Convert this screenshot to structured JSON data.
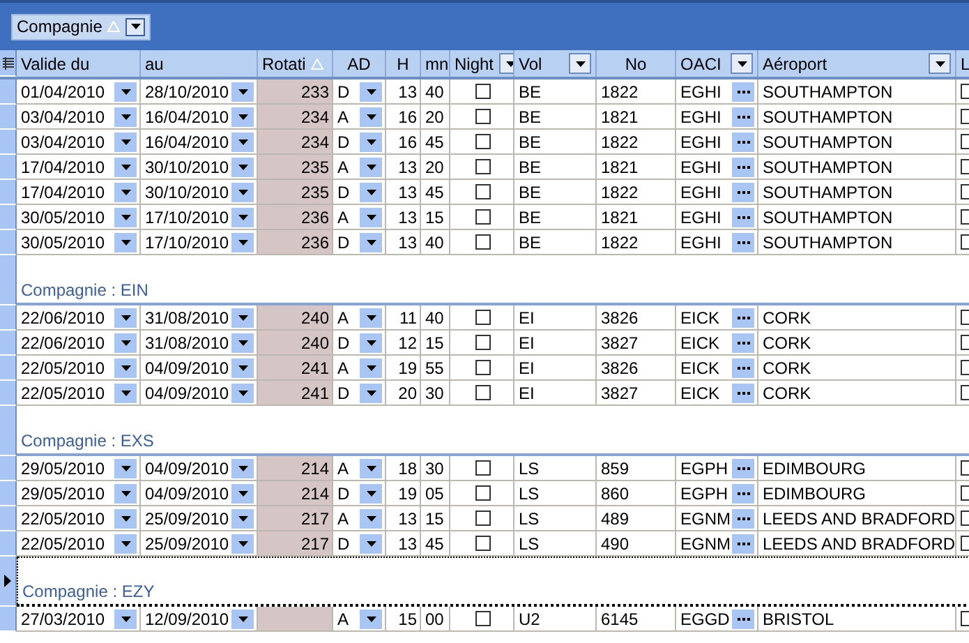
{
  "group_by": {
    "label": "Compagnie",
    "sorted": true,
    "filter": true
  },
  "columns": [
    {
      "label": "Valide du"
    },
    {
      "label": "au"
    },
    {
      "label": "Rotati",
      "sorted": true
    },
    {
      "label": "AD"
    },
    {
      "label": "H"
    },
    {
      "label": "mn"
    },
    {
      "label": "Night",
      "filter": true
    },
    {
      "label": "Vol",
      "filter": true
    },
    {
      "label": "No"
    },
    {
      "label": "OACI",
      "filter": true
    },
    {
      "label": "Aéroport",
      "filter": true
    },
    {
      "label": "L"
    }
  ],
  "groups": [
    {
      "rows": [
        {
          "valid_from": "01/04/2010",
          "valid_to": "28/10/2010",
          "rotation": "233",
          "ad": "D",
          "h": "13",
          "mn": "40",
          "night": false,
          "vol": "BE",
          "no": "1822",
          "oaci": "EGHI",
          "airport": "SOUTHAMPTON",
          "l": false
        },
        {
          "valid_from": "03/04/2010",
          "valid_to": "16/04/2010",
          "rotation": "234",
          "ad": "A",
          "h": "16",
          "mn": "20",
          "night": false,
          "vol": "BE",
          "no": "1821",
          "oaci": "EGHI",
          "airport": "SOUTHAMPTON",
          "l": false
        },
        {
          "valid_from": "03/04/2010",
          "valid_to": "16/04/2010",
          "rotation": "234",
          "ad": "D",
          "h": "16",
          "mn": "45",
          "night": false,
          "vol": "BE",
          "no": "1822",
          "oaci": "EGHI",
          "airport": "SOUTHAMPTON",
          "l": false
        },
        {
          "valid_from": "17/04/2010",
          "valid_to": "30/10/2010",
          "rotation": "235",
          "ad": "A",
          "h": "13",
          "mn": "20",
          "night": false,
          "vol": "BE",
          "no": "1821",
          "oaci": "EGHI",
          "airport": "SOUTHAMPTON",
          "l": false
        },
        {
          "valid_from": "17/04/2010",
          "valid_to": "30/10/2010",
          "rotation": "235",
          "ad": "D",
          "h": "13",
          "mn": "45",
          "night": false,
          "vol": "BE",
          "no": "1822",
          "oaci": "EGHI",
          "airport": "SOUTHAMPTON",
          "l": false
        },
        {
          "valid_from": "30/05/2010",
          "valid_to": "17/10/2010",
          "rotation": "236",
          "ad": "A",
          "h": "13",
          "mn": "15",
          "night": false,
          "vol": "BE",
          "no": "1821",
          "oaci": "EGHI",
          "airport": "SOUTHAMPTON",
          "l": false
        },
        {
          "valid_from": "30/05/2010",
          "valid_to": "17/10/2010",
          "rotation": "236",
          "ad": "D",
          "h": "13",
          "mn": "40",
          "night": false,
          "vol": "BE",
          "no": "1822",
          "oaci": "EGHI",
          "airport": "SOUTHAMPTON",
          "l": false
        }
      ]
    },
    {
      "label": "Compagnie : EIN",
      "selected": false,
      "rows": [
        {
          "valid_from": "22/06/2010",
          "valid_to": "31/08/2010",
          "rotation": "240",
          "ad": "A",
          "h": "11",
          "mn": "40",
          "night": false,
          "vol": "EI",
          "no": "3826",
          "oaci": "EICK",
          "airport": "CORK",
          "l": false
        },
        {
          "valid_from": "22/06/2010",
          "valid_to": "31/08/2010",
          "rotation": "240",
          "ad": "D",
          "h": "12",
          "mn": "15",
          "night": false,
          "vol": "EI",
          "no": "3827",
          "oaci": "EICK",
          "airport": "CORK",
          "l": false
        },
        {
          "valid_from": "22/05/2010",
          "valid_to": "04/09/2010",
          "rotation": "241",
          "ad": "A",
          "h": "19",
          "mn": "55",
          "night": false,
          "vol": "EI",
          "no": "3826",
          "oaci": "EICK",
          "airport": "CORK",
          "l": false
        },
        {
          "valid_from": "22/05/2010",
          "valid_to": "04/09/2010",
          "rotation": "241",
          "ad": "D",
          "h": "20",
          "mn": "30",
          "night": false,
          "vol": "EI",
          "no": "3827",
          "oaci": "EICK",
          "airport": "CORK",
          "l": false
        }
      ]
    },
    {
      "label": "Compagnie : EXS",
      "selected": false,
      "rows": [
        {
          "valid_from": "29/05/2010",
          "valid_to": "04/09/2010",
          "rotation": "214",
          "ad": "A",
          "h": "18",
          "mn": "30",
          "night": false,
          "vol": "LS",
          "no": "859",
          "oaci": "EGPH",
          "airport": "EDIMBOURG",
          "l": false
        },
        {
          "valid_from": "29/05/2010",
          "valid_to": "04/09/2010",
          "rotation": "214",
          "ad": "D",
          "h": "19",
          "mn": "05",
          "night": false,
          "vol": "LS",
          "no": "860",
          "oaci": "EGPH",
          "airport": "EDIMBOURG",
          "l": false
        },
        {
          "valid_from": "22/05/2010",
          "valid_to": "25/09/2010",
          "rotation": "217",
          "ad": "A",
          "h": "13",
          "mn": "15",
          "night": false,
          "vol": "LS",
          "no": "489",
          "oaci": "EGNM",
          "airport": "LEEDS AND BRADFORD",
          "l": false
        },
        {
          "valid_from": "22/05/2010",
          "valid_to": "25/09/2010",
          "rotation": "217",
          "ad": "D",
          "h": "13",
          "mn": "45",
          "night": false,
          "vol": "LS",
          "no": "490",
          "oaci": "EGNM",
          "airport": "LEEDS AND BRADFORD",
          "l": false
        }
      ]
    },
    {
      "label": "Compagnie : EZY",
      "selected": true,
      "rows": [
        {
          "valid_from": "27/03/2010",
          "valid_to": "12/09/2010",
          "ad": "A",
          "h": "15",
          "mn": "00",
          "night": false,
          "vol": "U2",
          "no": "6145",
          "oaci": "EGGD",
          "airport": "BRISTOL",
          "l": false
        }
      ]
    }
  ]
}
